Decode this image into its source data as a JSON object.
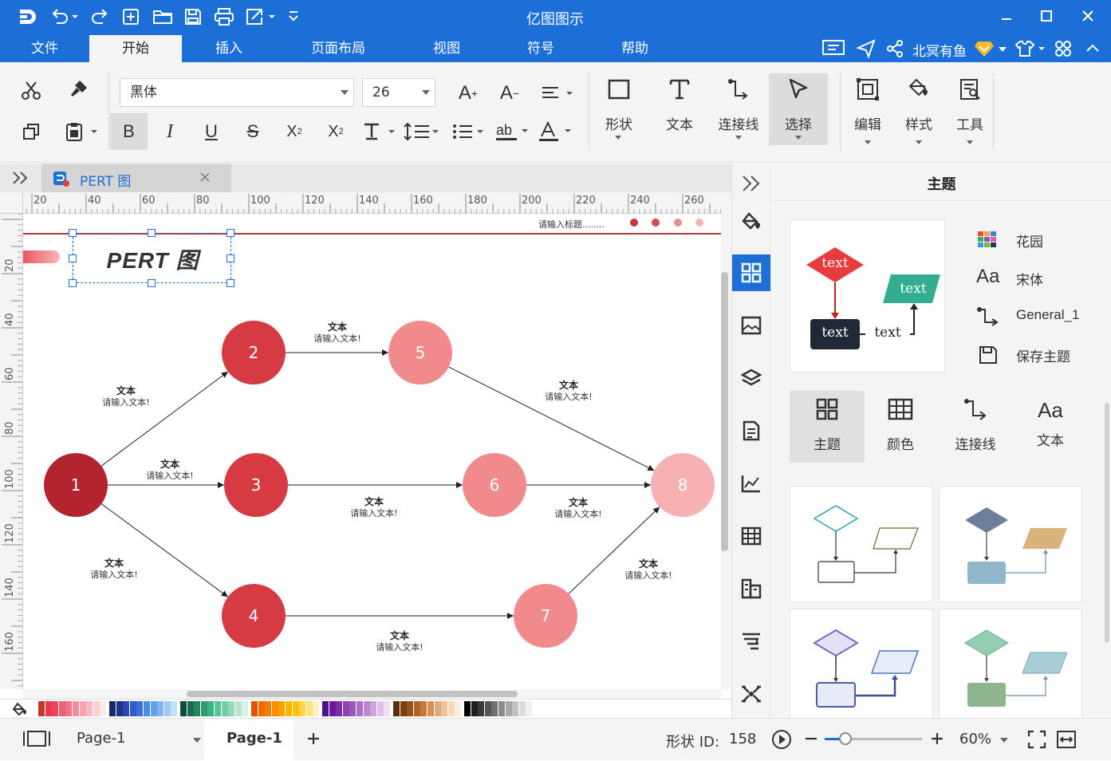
{
  "app": {
    "title": "亿图图示"
  },
  "quick_access": [
    "logo-icon",
    "undo-icon",
    "redo-icon",
    "new-icon",
    "open-icon",
    "save-icon",
    "print-icon",
    "export-icon",
    "more-icon"
  ],
  "menu": {
    "items": [
      "文件",
      "开始",
      "插入",
      "页面布局",
      "视图",
      "符号",
      "帮助"
    ],
    "active": "开始"
  },
  "user": {
    "name": "北冥有鱼"
  },
  "ribbon": {
    "font_family": "黑体",
    "font_size": "26",
    "big_buttons": [
      {
        "id": "shape",
        "label": "形状"
      },
      {
        "id": "text",
        "label": "文本"
      },
      {
        "id": "connector",
        "label": "连接线"
      },
      {
        "id": "select",
        "label": "选择"
      },
      {
        "id": "edit",
        "label": "编辑"
      },
      {
        "id": "style",
        "label": "样式"
      },
      {
        "id": "tools",
        "label": "工具"
      }
    ]
  },
  "doc_tab": {
    "title": "PERT 图"
  },
  "ruler": {
    "h_ticks": [
      "20",
      "40",
      "60",
      "80",
      "100",
      "120",
      "140",
      "160",
      "180",
      "200",
      "220",
      "240",
      "260"
    ],
    "v_ticks": [
      "20",
      "40",
      "60",
      "80",
      "100",
      "120",
      "140",
      "160"
    ]
  },
  "diagram": {
    "title": "PERT 图",
    "header_hint": "请输入标题........",
    "nodes": [
      {
        "id": "1",
        "label": "1",
        "color": "#b3242f"
      },
      {
        "id": "2",
        "label": "2",
        "color": "#d63a43"
      },
      {
        "id": "3",
        "label": "3",
        "color": "#d63a43"
      },
      {
        "id": "4",
        "label": "4",
        "color": "#d63a43"
      },
      {
        "id": "5",
        "label": "5",
        "color": "#f08a8c"
      },
      {
        "id": "6",
        "label": "6",
        "color": "#f08a8c"
      },
      {
        "id": "7",
        "label": "7",
        "color": "#f08a8c"
      },
      {
        "id": "8",
        "label": "8",
        "color": "#f7b1b3"
      }
    ],
    "edge_label": {
      "title": "文本",
      "subtitle": "请输入文本!"
    },
    "edges": [
      [
        "1",
        "2"
      ],
      [
        "1",
        "3"
      ],
      [
        "1",
        "4"
      ],
      [
        "2",
        "5"
      ],
      [
        "3",
        "6"
      ],
      [
        "4",
        "7"
      ],
      [
        "5",
        "8"
      ],
      [
        "6",
        "8"
      ],
      [
        "7",
        "8"
      ]
    ]
  },
  "panel": {
    "title": "主题",
    "preview_text": "text",
    "options": [
      {
        "icon": "color-grid-icon",
        "label": "花园"
      },
      {
        "icon": "font-aa-icon",
        "label": "宋体"
      },
      {
        "icon": "connector-icon",
        "label": "General_1"
      },
      {
        "icon": "save-theme-icon",
        "label": "保存主题"
      }
    ],
    "tabs": [
      {
        "icon": "theme-grid-icon",
        "label": "主题",
        "active": true
      },
      {
        "icon": "color-table-icon",
        "label": "颜色",
        "active": false
      },
      {
        "icon": "connector-icon",
        "label": "连接线",
        "active": false
      },
      {
        "icon": "font-aa-icon",
        "label": "文本",
        "active": false
      }
    ]
  },
  "status": {
    "page_selector": "Page-1",
    "page_tab": "Page-1",
    "shape_id_label": "形状 ID:",
    "shape_id_value": "158",
    "zoom": "60%",
    "zoom_level": 0.6
  }
}
